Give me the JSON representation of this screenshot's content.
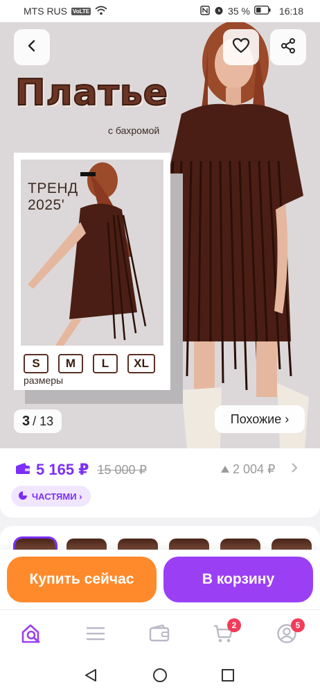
{
  "status_bar": {
    "carrier": "MTS RUS",
    "volte": "VoLTE",
    "battery": "35 %",
    "time": "16:18"
  },
  "hero": {
    "title": "Платье",
    "subtitle": "с бахромой",
    "trend": "ТРЕНД 2025'",
    "sizes": [
      "S",
      "M",
      "L",
      "XL"
    ],
    "sizes_label": "размеры",
    "counter_current": "3",
    "counter_total": "/ 13",
    "similar_label": "Похожие ›"
  },
  "price": {
    "current": "5 165 ₽",
    "old": "15 000 ₽",
    "bonus": "2 004 ₽",
    "installments_label": "ЧАСТЯМИ ›"
  },
  "thumbnails": {
    "count_visible": 6,
    "active_index": 0
  },
  "actions": {
    "buy_now": "Купить сейчас",
    "add_to_cart": "В корзину"
  },
  "tabbar": {
    "cart_badge": "2",
    "profile_badge": "5"
  },
  "colors": {
    "accent": "#7b2ff7",
    "buy": "#ff8a2b",
    "cart": "#9b3ff5",
    "badge": "#f23c5a"
  },
  "icons": [
    "back-icon",
    "heart-icon",
    "share-icon",
    "wallet-icon",
    "pie-icon",
    "home-search-icon",
    "menu-icon",
    "wallet-tab-icon",
    "cart-icon",
    "profile-icon"
  ]
}
